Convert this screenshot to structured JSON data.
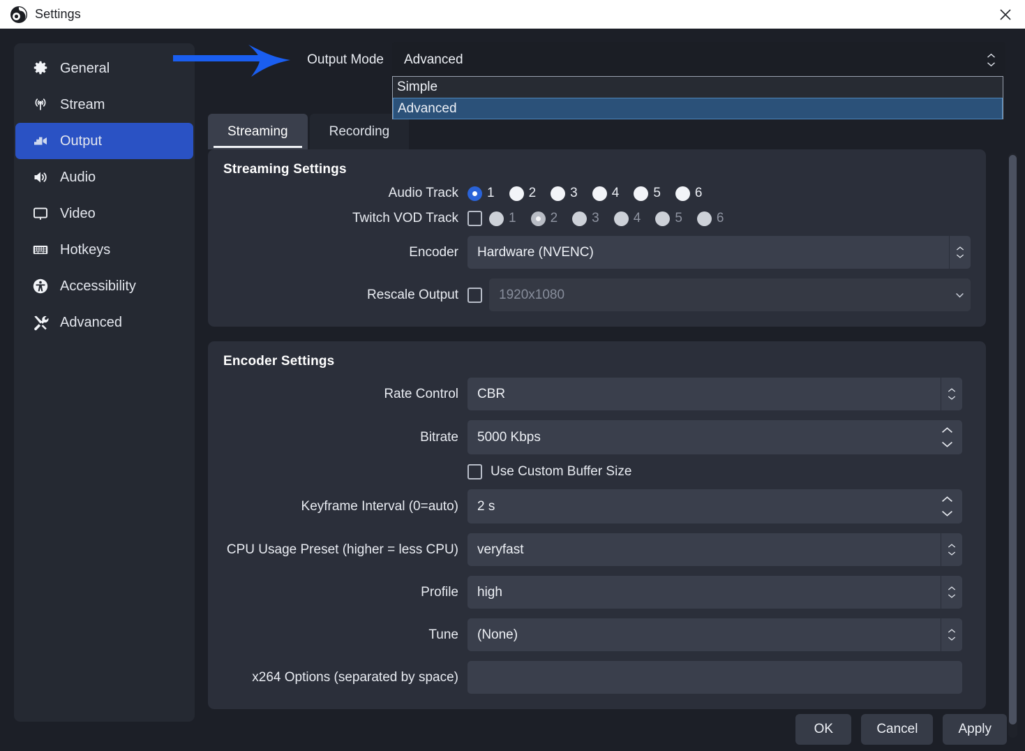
{
  "window": {
    "title": "Settings",
    "logo_icon": "obs-logo-icon",
    "close_icon": "close-icon"
  },
  "sidebar": {
    "items": [
      {
        "label": "General",
        "icon": "gear-icon",
        "active": false
      },
      {
        "label": "Stream",
        "icon": "broadcast-icon",
        "active": false
      },
      {
        "label": "Output",
        "icon": "output-camera-icon",
        "active": true
      },
      {
        "label": "Audio",
        "icon": "speaker-icon",
        "active": false
      },
      {
        "label": "Video",
        "icon": "monitor-icon",
        "active": false
      },
      {
        "label": "Hotkeys",
        "icon": "keyboard-icon",
        "active": false
      },
      {
        "label": "Accessibility",
        "icon": "accessibility-icon",
        "active": false
      },
      {
        "label": "Advanced",
        "icon": "tools-icon",
        "active": false
      }
    ]
  },
  "output_mode": {
    "label": "Output Mode",
    "value": "Advanced",
    "options": [
      "Simple",
      "Advanced"
    ],
    "selected_option": "Advanced",
    "dropdown_open": true
  },
  "tabs": [
    {
      "label": "Streaming",
      "active": true
    },
    {
      "label": "Recording",
      "active": false
    }
  ],
  "streaming_settings": {
    "title": "Streaming Settings",
    "audio_track": {
      "label": "Audio Track",
      "options": [
        "1",
        "2",
        "3",
        "4",
        "5",
        "6"
      ],
      "selected": "1"
    },
    "twitch_vod_track": {
      "label": "Twitch VOD Track",
      "enabled": false,
      "options": [
        "1",
        "2",
        "3",
        "4",
        "5",
        "6"
      ],
      "selected": "2"
    },
    "encoder": {
      "label": "Encoder",
      "value": "Hardware (NVENC)"
    },
    "rescale_output": {
      "label": "Rescale Output",
      "enabled": false,
      "value": "1920x1080"
    }
  },
  "encoder_settings": {
    "title": "Encoder Settings",
    "rate_control": {
      "label": "Rate Control",
      "value": "CBR"
    },
    "bitrate": {
      "label": "Bitrate",
      "value": "5000 Kbps"
    },
    "custom_buffer": {
      "label": "Use Custom Buffer Size",
      "checked": false
    },
    "keyframe": {
      "label": "Keyframe Interval (0=auto)",
      "value": "2 s"
    },
    "cpu_preset": {
      "label": "CPU Usage Preset (higher = less CPU)",
      "value": "veryfast"
    },
    "profile": {
      "label": "Profile",
      "value": "high"
    },
    "tune": {
      "label": "Tune",
      "value": "(None)"
    },
    "x264_options": {
      "label": "x264 Options (separated by space)",
      "value": ""
    }
  },
  "footer": {
    "ok": "OK",
    "cancel": "Cancel",
    "apply": "Apply"
  },
  "annotation": {
    "arrow_icon": "blue-right-arrow-annotation",
    "color": "#1a5ef0"
  },
  "colors": {
    "accent": "#2a52c4",
    "highlight": "#2b5179",
    "panel": "#2b2f3a",
    "page_bg": "#1c1f27",
    "field": "#3a3f4c"
  }
}
